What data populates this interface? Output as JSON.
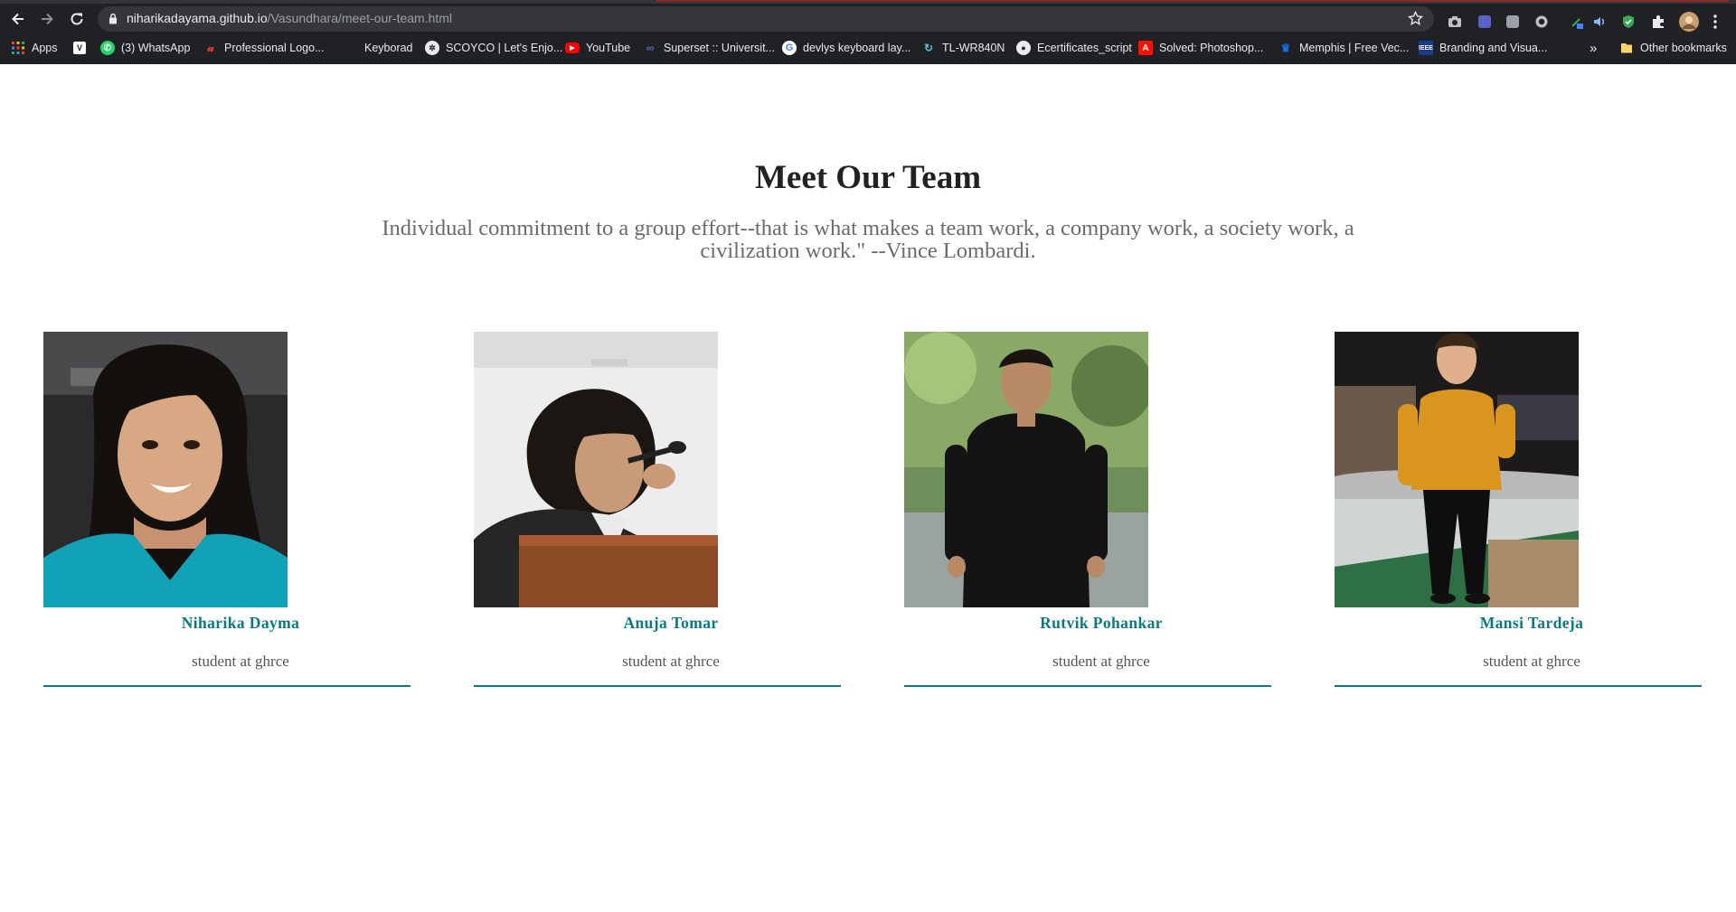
{
  "browser": {
    "url_host": "niharikadayama.github.io",
    "url_path": "/Vasundhara/meet-our-team.html",
    "bookmarks": [
      {
        "label": "Apps",
        "icon": "apps-grid-icon"
      },
      {
        "label": "",
        "icon": "vim-icon"
      },
      {
        "label": "(3) WhatsApp",
        "icon": "whatsapp-icon"
      },
      {
        "label": "Professional Logo...",
        "icon": "logo-maker-icon"
      },
      {
        "label": "Keyborad",
        "icon": "blank-page-icon"
      },
      {
        "label": "SCOYCO | Let's Enjo...",
        "icon": "scoyco-icon"
      },
      {
        "label": "YouTube",
        "icon": "youtube-icon"
      },
      {
        "label": "Superset :: Universit...",
        "icon": "superset-icon"
      },
      {
        "label": "devlys keyboard lay...",
        "icon": "google-icon"
      },
      {
        "label": "TL-WR840N",
        "icon": "tplink-icon"
      },
      {
        "label": "Ecertificates_script",
        "icon": "github-icon"
      },
      {
        "label": "Solved: Photoshop...",
        "icon": "adobe-icon"
      },
      {
        "label": "Memphis | Free Vec...",
        "icon": "freepik-icon"
      },
      {
        "label": "Branding and Visua...",
        "icon": "ieee-icon"
      }
    ],
    "more_bookmarks": "»",
    "other_bookmarks": "Other bookmarks"
  },
  "page": {
    "title": "Meet Our Team",
    "subtitle": "Individual commitment to a group effort--that is what makes a team work, a company work, a society work, a civilization work.\" --Vince Lombardi."
  },
  "team": [
    {
      "name": "Niharika Dayma",
      "role": "student at ghrce"
    },
    {
      "name": "Anuja Tomar",
      "role": "student at ghrce"
    },
    {
      "name": "Rutvik Pohankar",
      "role": "student at ghrce"
    },
    {
      "name": "Mansi Tardeja",
      "role": "student at ghrce"
    }
  ],
  "colors": {
    "accent": "#0b7a80",
    "chrome": "#202124",
    "omnibox": "#35363a"
  }
}
